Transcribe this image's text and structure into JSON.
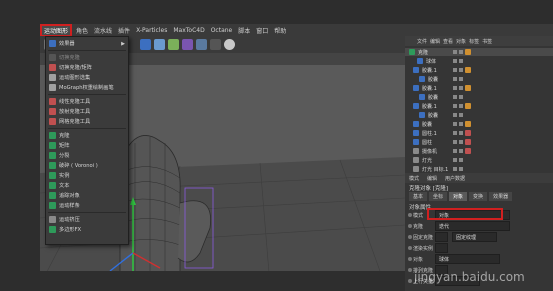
{
  "menubar": {
    "items": [
      {
        "label": "运动图形",
        "active": true
      },
      {
        "label": "角色",
        "active": false
      },
      {
        "label": "流水线",
        "active": false
      },
      {
        "label": "插件",
        "active": false
      },
      {
        "label": "X-Particles",
        "active": false
      },
      {
        "label": "MaxToC4D",
        "active": false
      },
      {
        "label": "Octane",
        "active": false
      },
      {
        "label": "脚本",
        "active": false
      },
      {
        "label": "窗口",
        "active": false
      },
      {
        "label": "帮助",
        "active": false
      }
    ]
  },
  "dropdown": {
    "items": [
      {
        "label": "效果器",
        "dim": false,
        "submenu": true,
        "icon_color": "#3c6fc0"
      },
      {
        "label": "切换克隆",
        "dim": true,
        "submenu": false,
        "icon_color": "#555555"
      },
      {
        "label": "切换克隆/矩阵",
        "dim": false,
        "submenu": false,
        "icon_color": "#c05050"
      },
      {
        "label": "运动图形选集",
        "dim": false,
        "submenu": false,
        "icon_color": "#a0a0a0"
      },
      {
        "label": "MoGraph权重绘制画笔",
        "dim": false,
        "submenu": false,
        "icon_color": "#a0a0a0"
      },
      {
        "label": "线性克隆工具",
        "dim": false,
        "submenu": false,
        "icon_color": "#c05050"
      },
      {
        "label": "放射克隆工具",
        "dim": false,
        "submenu": false,
        "icon_color": "#c05050"
      },
      {
        "label": "网格克隆工具",
        "dim": false,
        "submenu": false,
        "icon_color": "#c05050"
      },
      {
        "label": "克隆",
        "dim": false,
        "submenu": false,
        "icon_color": "#2e9a5a"
      },
      {
        "label": "矩阵",
        "dim": false,
        "submenu": false,
        "icon_color": "#2e9a5a"
      },
      {
        "label": "分裂",
        "dim": false,
        "submenu": false,
        "icon_color": "#2e9a5a"
      },
      {
        "label": "破碎 ( Voronoi )",
        "dim": false,
        "submenu": false,
        "icon_color": "#2e9a5a"
      },
      {
        "label": "实例",
        "dim": false,
        "submenu": false,
        "icon_color": "#2e9a5a"
      },
      {
        "label": "文本",
        "dim": false,
        "submenu": false,
        "icon_color": "#2e9a5a"
      },
      {
        "label": "追踪对象",
        "dim": false,
        "submenu": false,
        "icon_color": "#2e9a5a"
      },
      {
        "label": "运动样条",
        "dim": false,
        "submenu": false,
        "icon_color": "#2e9a5a"
      },
      {
        "label": "运动挤压",
        "dim": false,
        "submenu": false,
        "icon_color": "#8a8a8a"
      },
      {
        "label": "多边形FX",
        "dim": false,
        "submenu": false,
        "icon_color": "#2e9a5a"
      }
    ]
  },
  "objects": {
    "tabs": [
      "文件",
      "编辑",
      "查看",
      "对象",
      "标签",
      "书签"
    ],
    "rows": [
      {
        "label": "克隆",
        "icon_color": "#2e9a5a",
        "tag_color": "#d09030"
      },
      {
        "label": "球体",
        "icon_color": "#3c6fc0",
        "tag_color": ""
      },
      {
        "label": "胶囊.1",
        "icon_color": "#3c6fc0",
        "tag_color": "#d09030"
      },
      {
        "label": "胶囊",
        "icon_color": "#3c6fc0",
        "tag_color": ""
      },
      {
        "label": "胶囊.1",
        "icon_color": "#3c6fc0",
        "tag_color": "#d09030"
      },
      {
        "label": "胶囊",
        "icon_color": "#3c6fc0",
        "tag_color": ""
      },
      {
        "label": "胶囊.1",
        "icon_color": "#3c6fc0",
        "tag_color": "#d09030"
      },
      {
        "label": "胶囊",
        "icon_color": "#3c6fc0",
        "tag_color": ""
      },
      {
        "label": "胶囊",
        "icon_color": "#3c6fc0",
        "tag_color": "#d09030"
      },
      {
        "label": "圆柱.1",
        "icon_color": "#3c6fc0",
        "tag_color": "#c05050"
      },
      {
        "label": "圆柱",
        "icon_color": "#3c6fc0",
        "tag_color": "#c05050"
      },
      {
        "label": "摄像机",
        "icon_color": "#8a8a8a",
        "tag_color": "#c05050"
      },
      {
        "label": "灯光",
        "icon_color": "#8a8a8a",
        "tag_color": ""
      },
      {
        "label": "灯光 目标.1",
        "icon_color": "#8a8a8a",
        "tag_color": ""
      }
    ]
  },
  "attributes": {
    "header_tabs": [
      "模式",
      "编辑",
      "用户数据"
    ],
    "title": "克隆对象 [克隆]",
    "tabs": [
      {
        "label": "基本",
        "selected": false
      },
      {
        "label": "坐标",
        "selected": false
      },
      {
        "label": "对象",
        "selected": true
      },
      {
        "label": "变换",
        "selected": false
      },
      {
        "label": "效果器",
        "selected": false
      }
    ],
    "section": "对象属性",
    "fields": [
      {
        "label": "模式",
        "value": "对象"
      },
      {
        "label": "克隆",
        "value": "迭代"
      },
      {
        "label": "固定克隆",
        "value": "固定纹理"
      },
      {
        "label": "渲染实例",
        "value": ""
      },
      {
        "label": "对象",
        "value": "球体"
      },
      {
        "label": "排列克隆",
        "value": ""
      },
      {
        "label": "上行矢量",
        "value": ""
      }
    ]
  },
  "watermark": "jingyan.baidu.com"
}
